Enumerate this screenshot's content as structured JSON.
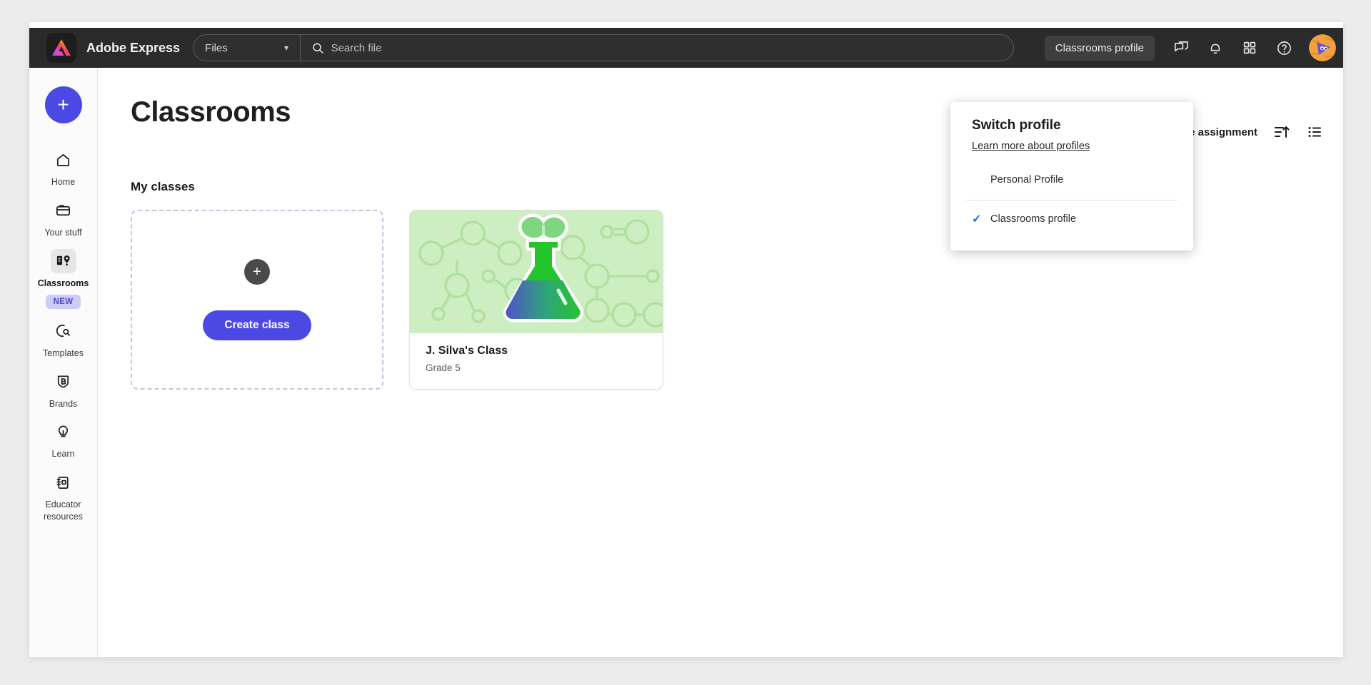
{
  "header": {
    "logo_icon": "adobe-express-logo",
    "brand": "Adobe Express",
    "file_select": {
      "value": "Files",
      "chevron_icon": "chevron-down-icon"
    },
    "search": {
      "placeholder": "Search file",
      "value": "",
      "icon": "search-icon"
    },
    "profile_pill": "Classrooms profile",
    "icons": [
      {
        "name": "chat-icon"
      },
      {
        "name": "bell-icon"
      },
      {
        "name": "apps-grid-icon"
      },
      {
        "name": "help-circle-icon"
      }
    ],
    "avatar_icon": "user-avatar"
  },
  "sidebar": {
    "create_fab": {
      "label": "+",
      "icon": "plus-icon",
      "color": "#4a49e4"
    },
    "items": [
      {
        "label": "Home",
        "icon": "home-icon",
        "active": false,
        "badge": ""
      },
      {
        "label": "Your stuff",
        "icon": "folder-icon",
        "active": false,
        "badge": ""
      },
      {
        "label": "Classrooms",
        "icon": "classrooms-icon",
        "active": true,
        "badge": "NEW"
      },
      {
        "label": "Templates",
        "icon": "templates-search-icon",
        "active": false,
        "badge": ""
      },
      {
        "label": "Brands",
        "icon": "brand-shield-icon",
        "active": false,
        "badge": ""
      },
      {
        "label": "Learn",
        "icon": "lightbulb-icon",
        "active": false,
        "badge": ""
      },
      {
        "label": "Educator\nresources",
        "icon": "notebook-icon",
        "active": false,
        "badge": ""
      }
    ]
  },
  "main": {
    "page_title": "Classrooms",
    "toolbar": {
      "create_assignment": "Create assignment",
      "sort_icon": "sort-ascending-icon",
      "view_icon": "list-view-icon"
    },
    "section_title": "My classes",
    "create_card": {
      "plus_icon": "plus-icon",
      "button_label": "Create class"
    },
    "classes": [
      {
        "name": "J. Silva's Class",
        "grade": "Grade 5",
        "thumb_icon": "science-flask-illustration",
        "thumb_bg": "#cdeec1"
      }
    ]
  },
  "profile_menu": {
    "title": "Switch profile",
    "link": "Learn more about profiles",
    "options": [
      {
        "label": "Personal Profile",
        "selected": false
      },
      {
        "label": "Classrooms profile",
        "selected": true
      }
    ],
    "check_icon": "check-icon",
    "check_color": "#1473e6"
  }
}
